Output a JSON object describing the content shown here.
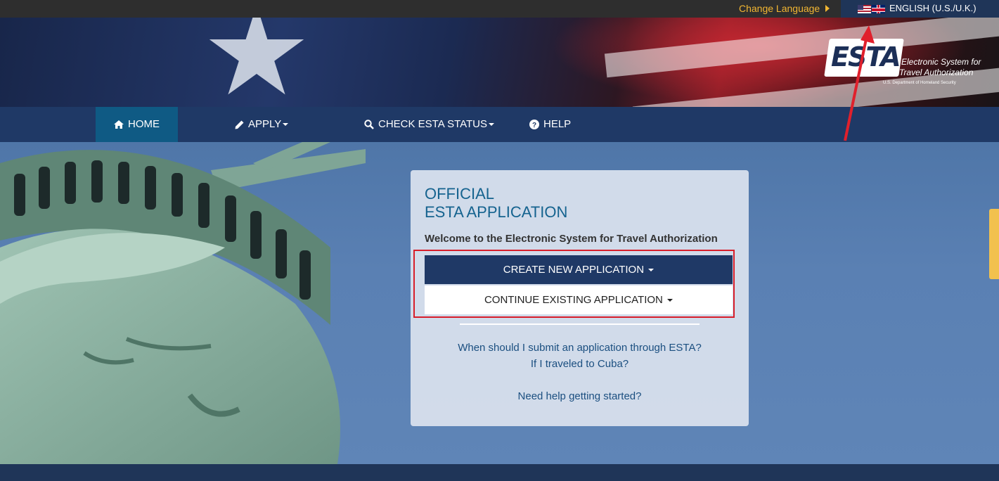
{
  "topbar": {
    "change_language": "Change Language",
    "current_language": "ENGLISH (U.S./U.K.)"
  },
  "logo": {
    "word": "ESTA",
    "subtitle_line1": "Electronic System for",
    "subtitle_line2": "Travel Authorization",
    "department": "U.S. Department of Homeland Security"
  },
  "nav": {
    "home": "HOME",
    "apply": "APPLY",
    "check_status": "CHECK ESTA STATUS",
    "help": "HELP"
  },
  "card": {
    "title_line1": "OFFICIAL",
    "title_line2": "ESTA APPLICATION",
    "welcome": "Welcome to the Electronic System for Travel Authorization",
    "create_button": "CREATE NEW APPLICATION",
    "continue_button": "CONTINUE EXISTING APPLICATION",
    "link_when": "When should I submit an application through ESTA?",
    "link_cuba": "If I traveled to Cuba?",
    "link_help": "Need help getting started?"
  },
  "colors": {
    "nav_bg": "#1f3966",
    "active_nav": "#0f5a84",
    "accent_gold": "#f2b632",
    "title_blue": "#15638f",
    "highlight_red": "#d81e2a"
  }
}
